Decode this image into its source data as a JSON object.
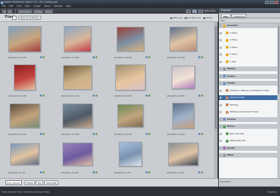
{
  "app": {
    "title": "Adobe Photoshop Album 2.0 - My Catalog.psa"
  },
  "menu": [
    "File",
    "Edit",
    "Find",
    "View",
    "Create",
    "Share",
    "Window",
    "Help"
  ],
  "toolbar": {
    "buttons": [
      "Get Photos",
      "Create",
      "Share"
    ],
    "view_label": "Date View"
  },
  "browser": {
    "find_label": "Find",
    "back_button": "Back to All Photos",
    "filters": [
      "Matching",
      "Not Matching",
      "Hidden"
    ],
    "captions": [
      "4/25/2003 12:27 PM",
      "4/25/2003 12:28 PM",
      "4/25/2003 12:30 PM",
      "4/25/2003 12:37 PM",
      "4/25/2003 12:40 PM",
      "4/25/2003 12:41 PM",
      "4/25/2003 12:43 PM",
      "4/25/2003 12:48 PM",
      "4/25/2003 12:50 PM",
      "4/25/2003 12:52 PM",
      "4/25/2003 12:53 PM",
      "4/25/2003 12:55 PM",
      "4/25/2003 1:02 PM",
      "4/25/2003 1:05 PM",
      "4/25/2003 1:07 PM",
      "4/25/2003 1:10 PM"
    ],
    "footer_pill": "Date (Newest First)",
    "footer_buttons": [
      "Rotate",
      "Tag",
      "Show Date"
    ]
  },
  "panel": {
    "title": "Organize",
    "tabs": [
      "Tags",
      "Collections"
    ],
    "tools": "New",
    "tags": [
      {
        "label": "Favorites",
        "type": "cat",
        "color": "#e2b12c"
      },
      {
        "label": "5 Stars",
        "type": "item",
        "color": "#e2b12c"
      },
      {
        "label": "4 Stars",
        "type": "item",
        "color": "#e2b12c"
      },
      {
        "label": "3 Stars",
        "type": "item",
        "color": "#e2b12c"
      },
      {
        "label": "2 Stars",
        "type": "item",
        "color": "#e2b12c"
      },
      {
        "label": "1 Star",
        "type": "item",
        "color": "#e2b12c"
      },
      {
        "label": "Hidden",
        "type": "cat",
        "color": "#8f959c"
      },
      {
        "label": "People",
        "type": "cat",
        "color": "#6e8fbf"
      },
      {
        "label": "Family",
        "type": "cat",
        "color": "#6e8fbf"
      },
      {
        "label": "Gretchen, Whitney and Dawson Hosts",
        "type": "item",
        "color": "#c98a63"
      },
      {
        "label": "Dawson Hosts",
        "type": "sel",
        "color": "#c98a63"
      },
      {
        "label": "Whitney",
        "type": "item",
        "color": "#c98a63"
      },
      {
        "label": "Whitney and Dawson Hosts",
        "type": "item",
        "color": "#c98a63"
      },
      {
        "label": "Friends",
        "type": "cat",
        "color": "#6e8fbf"
      },
      {
        "label": "Places",
        "type": "cat",
        "color": "#5e9a60"
      },
      {
        "label": "New York City",
        "type": "item",
        "color": "#5e9a60"
      },
      {
        "label": "Washington DC",
        "type": "item",
        "color": "#5e9a60"
      },
      {
        "label": "Events",
        "type": "cat",
        "color": "#a26ab3"
      },
      {
        "label": "Other",
        "type": "cat",
        "color": "#8f959c"
      }
    ],
    "footer": "Tag Search"
  },
  "status": {
    "left": "Date (Newest First)  |  24 Items  |  Dawson Hosts",
    "right": "Organize"
  }
}
